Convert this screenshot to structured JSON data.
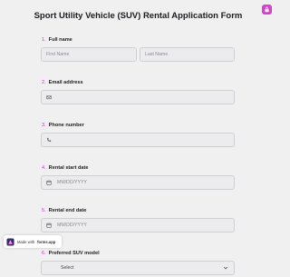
{
  "form": {
    "title": "Sport Utility Vehicle (SUV) Rental Application Form"
  },
  "questions": [
    {
      "number": "1.",
      "label": "Full name",
      "first_placeholder": "First Name",
      "last_placeholder": "Last Name"
    },
    {
      "number": "2.",
      "label": "Email address"
    },
    {
      "number": "3.",
      "label": "Phone number"
    },
    {
      "number": "4.",
      "label": "Rental start date",
      "placeholder": "MM/DD/YYYY"
    },
    {
      "number": "5.",
      "label": "Rental end date",
      "placeholder": "MM/DD/YYYY"
    },
    {
      "number": "6.",
      "label": "Preferred SUV model",
      "select_value": "Select"
    }
  ],
  "badge": {
    "prefix": "Made with",
    "brand": "forms.app"
  },
  "colors": {
    "accent": "#d63fd0",
    "background": "#f0f0f1"
  },
  "icons": {
    "corner": "lock-icon",
    "email": "mail-icon",
    "phone": "phone-icon",
    "date": "calendar-icon",
    "select": "chevron-down-icon"
  }
}
